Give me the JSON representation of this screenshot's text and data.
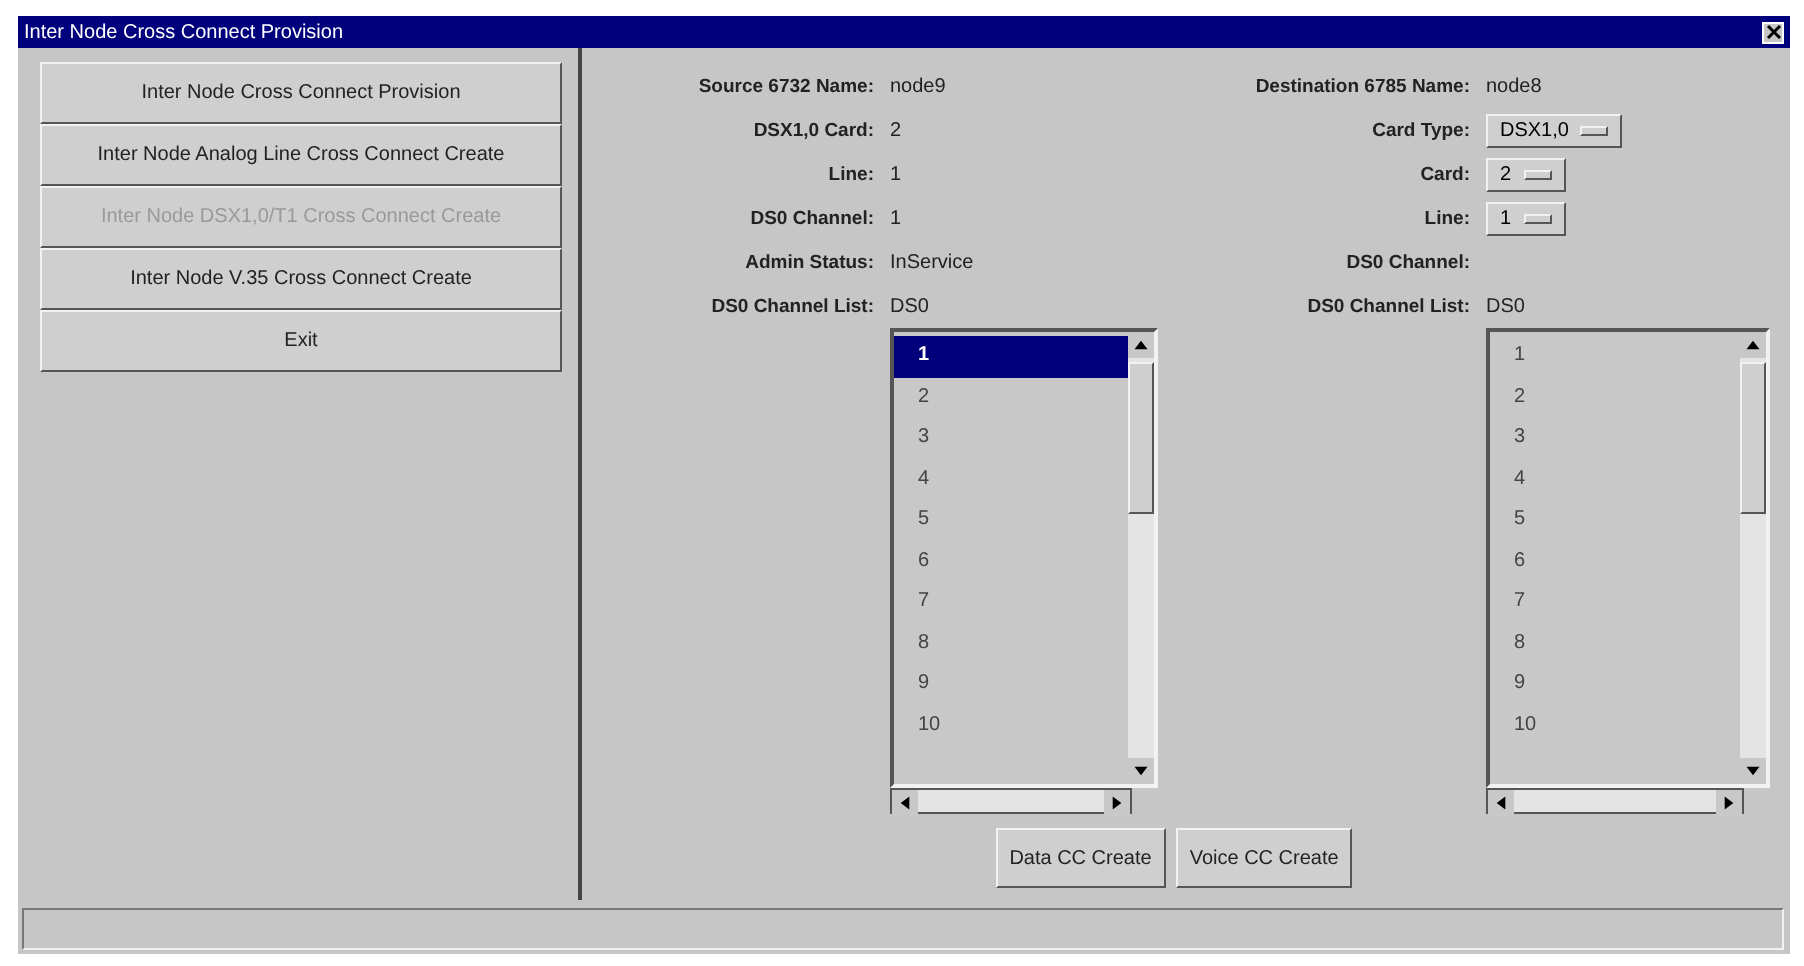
{
  "window": {
    "title": "Inter Node Cross Connect Provision"
  },
  "menu_buttons": [
    {
      "label": "Inter Node Cross Connect Provision",
      "disabled": false
    },
    {
      "label": "Inter Node Analog Line Cross Connect Create",
      "disabled": false
    },
    {
      "label": "Inter Node DSX1,0/T1 Cross Connect Create",
      "disabled": true
    },
    {
      "label": "Inter Node V.35 Cross Connect Create",
      "disabled": false
    },
    {
      "label": "Exit",
      "disabled": false
    }
  ],
  "source": {
    "fields": [
      {
        "label": "Source 6732 Name:",
        "kind": "text",
        "value": "node9"
      },
      {
        "label": "DSX1,0 Card:",
        "kind": "text",
        "value": "2"
      },
      {
        "label": "Line:",
        "kind": "text",
        "value": "1"
      },
      {
        "label": "DS0 Channel:",
        "kind": "text",
        "value": "1"
      },
      {
        "label": "Admin Status:",
        "kind": "text",
        "value": "InService"
      },
      {
        "label": "DS0 Channel List:",
        "kind": "text",
        "value": "DS0"
      }
    ],
    "channels": [
      {
        "label": "1",
        "selected": true
      },
      {
        "label": "2",
        "selected": false
      },
      {
        "label": "3",
        "selected": false
      },
      {
        "label": "4",
        "selected": false
      },
      {
        "label": "5",
        "selected": false
      },
      {
        "label": "6",
        "selected": false
      },
      {
        "label": "7",
        "selected": false
      },
      {
        "label": "8",
        "selected": false
      },
      {
        "label": "9",
        "selected": false
      },
      {
        "label": "10",
        "selected": false
      }
    ]
  },
  "destination": {
    "fields": [
      {
        "label": "Destination 6785 Name:",
        "kind": "text",
        "value": "node8"
      },
      {
        "label": "Card Type:",
        "kind": "dropdown",
        "value": "DSX1,0"
      },
      {
        "label": "Card:",
        "kind": "dropdown",
        "value": "2"
      },
      {
        "label": "Line:",
        "kind": "dropdown",
        "value": "1"
      },
      {
        "label": "DS0 Channel:",
        "kind": "text"
      },
      {
        "label": "DS0 Channel List:",
        "kind": "text",
        "value": "DS0"
      }
    ],
    "channels": [
      {
        "label": "1",
        "selected": false
      },
      {
        "label": "2",
        "selected": false
      },
      {
        "label": "3",
        "selected": false
      },
      {
        "label": "4",
        "selected": false
      },
      {
        "label": "5",
        "selected": false
      },
      {
        "label": "6",
        "selected": false
      },
      {
        "label": "7",
        "selected": false
      },
      {
        "label": "8",
        "selected": false
      },
      {
        "label": "9",
        "selected": false
      },
      {
        "label": "10",
        "selected": false
      }
    ]
  },
  "actions": [
    "Data CC Create",
    "Voice CC Create"
  ]
}
